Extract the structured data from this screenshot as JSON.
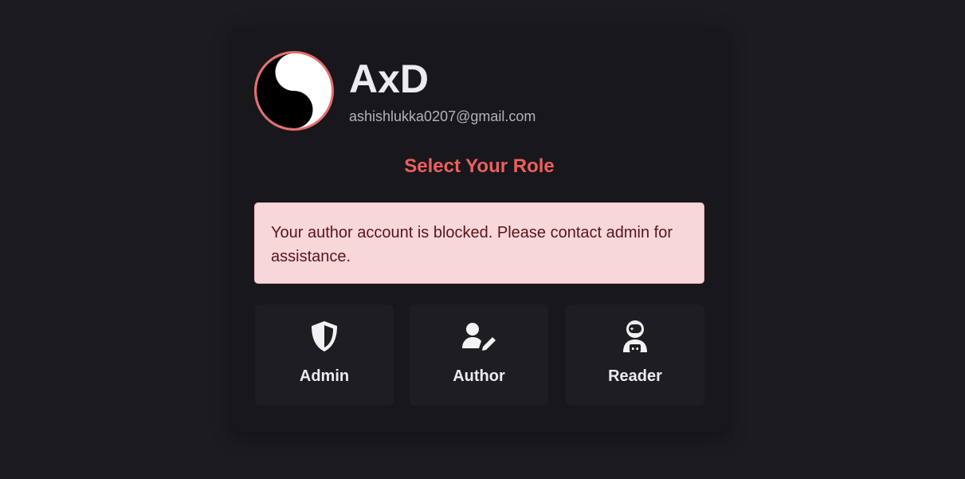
{
  "profile": {
    "name": "AxD",
    "email": "ashishlukka0207@gmail.com",
    "avatar_icon": "yin-yang-icon",
    "avatar_border_color": "#e46e6e"
  },
  "role_selection": {
    "title": "Select Your Role",
    "alert_message": "Your author account is blocked. Please contact admin for assistance.",
    "roles": [
      {
        "label": "Admin",
        "icon": "shield-icon"
      },
      {
        "label": "Author",
        "icon": "user-pen-icon"
      },
      {
        "label": "Reader",
        "icon": "user-astronaut-icon"
      }
    ]
  },
  "colors": {
    "background": "#1c1b20",
    "card": "#18171b",
    "accent": "#ec5f5f",
    "alert_background": "#f8d7da",
    "alert_text": "#58151c"
  }
}
